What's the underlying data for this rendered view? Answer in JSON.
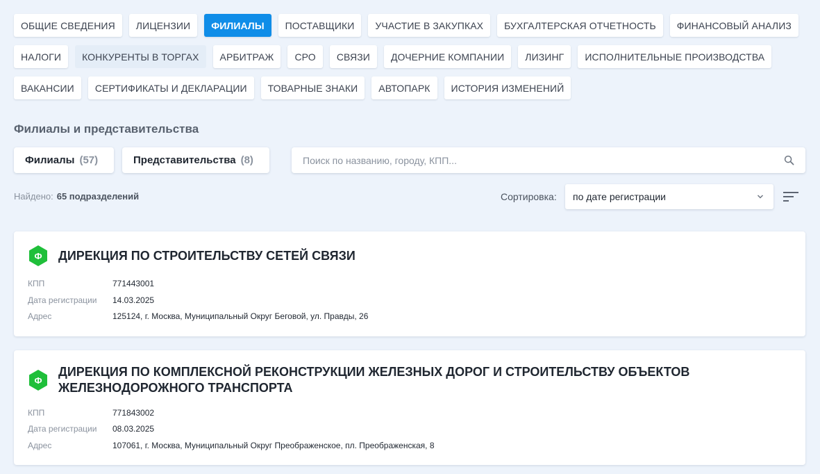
{
  "tabs": {
    "row1": [
      {
        "label": "ОБЩИЕ СВЕДЕНИЯ",
        "state": ""
      },
      {
        "label": "ЛИЦЕНЗИИ",
        "state": ""
      },
      {
        "label": "ФИЛИАЛЫ",
        "state": "active"
      },
      {
        "label": "ПОСТАВЩИКИ",
        "state": ""
      },
      {
        "label": "УЧАСТИЕ В ЗАКУПКАХ",
        "state": ""
      },
      {
        "label": "БУХГАЛТЕРСКАЯ ОТЧЕТНОСТЬ",
        "state": ""
      },
      {
        "label": "ФИНАНСОВЫЙ АНАЛИЗ",
        "state": ""
      }
    ],
    "row2": [
      {
        "label": "НАЛОГИ",
        "state": ""
      },
      {
        "label": "КОНКУРЕНТЫ В ТОРГАХ",
        "state": "hover"
      },
      {
        "label": "АРБИТРАЖ",
        "state": ""
      },
      {
        "label": "СРО",
        "state": ""
      },
      {
        "label": "СВЯЗИ",
        "state": ""
      },
      {
        "label": "ДОЧЕРНИЕ КОМПАНИИ",
        "state": ""
      },
      {
        "label": "ЛИЗИНГ",
        "state": ""
      },
      {
        "label": "ИСПОЛНИТЕЛЬНЫЕ ПРОИЗВОДСТВА",
        "state": ""
      }
    ],
    "row3": [
      {
        "label": "ВАКАНСИИ",
        "state": ""
      },
      {
        "label": "СЕРТИФИКАТЫ И ДЕКЛАРАЦИИ",
        "state": ""
      },
      {
        "label": "ТОВАРНЫЕ ЗНАКИ",
        "state": ""
      },
      {
        "label": "АВТОПАРК",
        "state": ""
      },
      {
        "label": "ИСТОРИЯ ИЗМЕНЕНИЙ",
        "state": ""
      }
    ]
  },
  "section": {
    "title": "Филиалы и представительства"
  },
  "segments": {
    "branches": {
      "label": "Филиалы",
      "count": "(57)"
    },
    "offices": {
      "label": "Представительства",
      "count": "(8)"
    }
  },
  "search": {
    "placeholder": "Поиск по названию, городу, КПП...",
    "value": ""
  },
  "results": {
    "found_label": "Найдено:",
    "found_value": "65 подразделений"
  },
  "sort": {
    "label": "Сортировка:",
    "value": "по дате регистрации"
  },
  "cards": [
    {
      "badge": "Ф",
      "title": "ДИРЕКЦИЯ ПО СТРОИТЕЛЬСТВУ СЕТЕЙ СВЯЗИ",
      "fields": [
        {
          "key": "КПП",
          "value": "771443001"
        },
        {
          "key": "Дата регистрации",
          "value": "14.03.2025"
        },
        {
          "key": "Адрес",
          "value": "125124, г. Москва, Муниципальный Округ Беговой, ул. Правды, 26"
        }
      ]
    },
    {
      "badge": "Ф",
      "title": "ДИРЕКЦИЯ ПО КОМПЛЕКСНОЙ РЕКОНСТРУКЦИИ ЖЕЛЕЗНЫХ ДОРОГ И СТРОИТЕЛЬСТВУ ОБЪЕКТОВ ЖЕЛЕЗНОДОРОЖНОГО ТРАНСПОРТА",
      "fields": [
        {
          "key": "КПП",
          "value": "771843002"
        },
        {
          "key": "Дата регистрации",
          "value": "08.03.2025"
        },
        {
          "key": "Адрес",
          "value": "107061, г. Москва, Муниципальный Округ Преображенское, пл. Преображенская, 8"
        }
      ]
    }
  ],
  "colors": {
    "accent": "#0f8de8",
    "badge": "#1fbf3a",
    "background": "#edf3fb"
  },
  "icons": {
    "search": "search-icon",
    "sort": "sort-lines-icon",
    "select": "chevron-down-icon",
    "branch": "hexagon-badge-icon"
  }
}
